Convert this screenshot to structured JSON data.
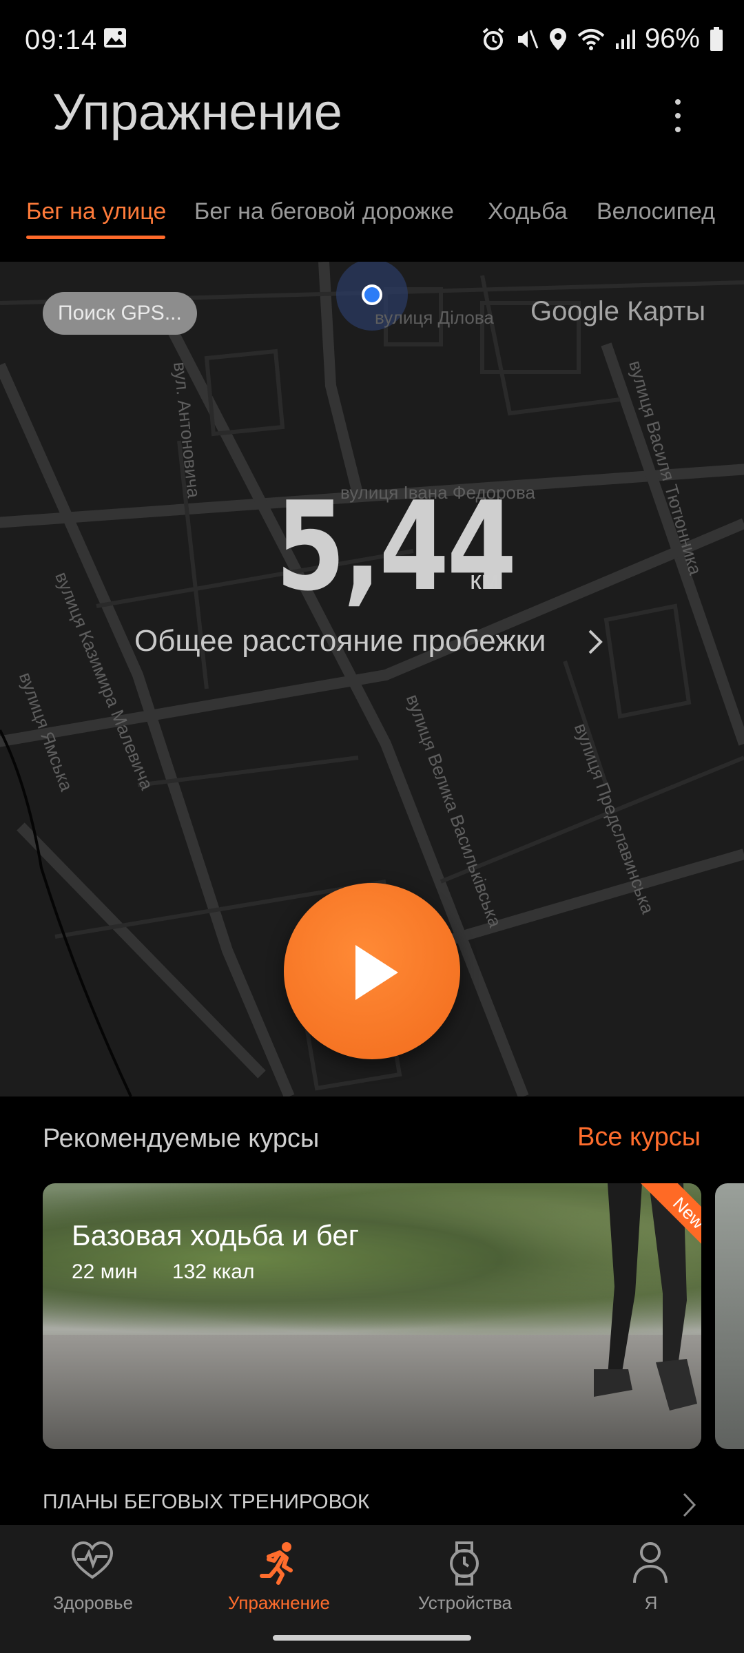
{
  "status_bar": {
    "time": "09:14",
    "battery": "96%",
    "icons": [
      "image-icon",
      "alarm-icon",
      "mute-icon",
      "location-icon",
      "wifi-icon",
      "signal-icon",
      "battery-icon"
    ]
  },
  "header": {
    "title": "Упражнение",
    "more_icon": "more-vert-icon"
  },
  "tabs": [
    {
      "label": "Бег на улице",
      "active": true
    },
    {
      "label": "Бег на беговой дорожке",
      "active": false
    },
    {
      "label": "Ходьба",
      "active": false
    },
    {
      "label": "Велосипед",
      "active": false
    }
  ],
  "map": {
    "gps_status": "Поиск GPS...",
    "provider_label": "Google Карты",
    "streets": [
      "вулиця Ділова",
      "вул. Антоновича",
      "вулиця Івана Федорова",
      "вулиця Василя Тютюнника",
      "вулиця Казимира Малевича",
      "вулиця Ямська",
      "вулиця Велика Васильківська",
      "вулиця Предславинська"
    ]
  },
  "distance": {
    "value": "5,44",
    "unit": "км",
    "caption": "Общее расстояние пробежки"
  },
  "start_button_icon": "play-icon",
  "recommended": {
    "title": "Рекомендуемые курсы",
    "all_link": "Все курсы",
    "card": {
      "title": "Базовая ходьба и бег",
      "duration": "22 мин",
      "calories": "132 ккал",
      "badge": "New"
    }
  },
  "plans": {
    "label": "ПЛАНЫ БЕГОВЫХ ТРЕНИРОВОК"
  },
  "bottom_nav": [
    {
      "label": "Здоровье",
      "icon": "heart-pulse-icon",
      "active": false
    },
    {
      "label": "Упражнение",
      "icon": "running-icon",
      "active": true
    },
    {
      "label": "Устройства",
      "icon": "watch-icon",
      "active": false
    },
    {
      "label": "Я",
      "icon": "person-icon",
      "active": false
    }
  ],
  "colors": {
    "accent": "#ff6d2d",
    "background": "#000000",
    "map_background": "#1c1c1c"
  }
}
